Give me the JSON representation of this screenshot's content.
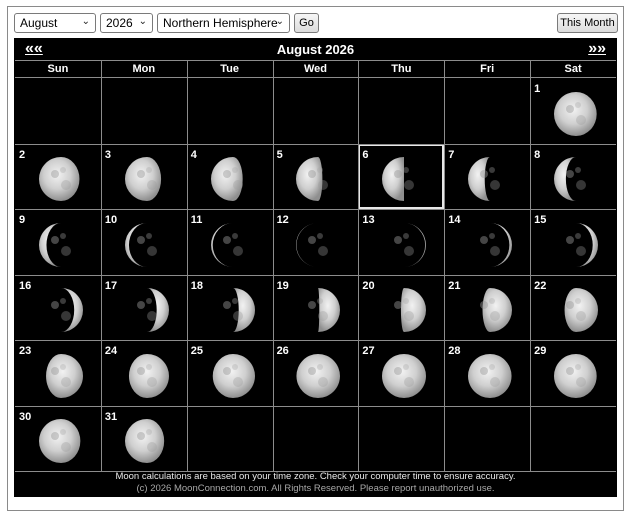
{
  "toolbar": {
    "month_value": "August",
    "year_value": "2026",
    "hemisphere_value": "Northern Hemisphere",
    "go_label": "Go",
    "this_month_label": "This Month"
  },
  "calendar": {
    "title": "August 2026",
    "prev_label": "«",
    "next_label": "»",
    "weekdays": [
      "Sun",
      "Mon",
      "Tue",
      "Wed",
      "Thu",
      "Fri",
      "Sat"
    ],
    "first_weekday_index": 6,
    "days_in_month": 31,
    "highlighted_day": 6,
    "days": [
      {
        "day": 1,
        "phase": 0.97
      },
      {
        "day": 2,
        "phase": 0.92
      },
      {
        "day": 3,
        "phase": 0.82
      },
      {
        "day": 4,
        "phase": 0.72
      },
      {
        "day": 5,
        "phase": 0.6
      },
      {
        "day": 6,
        "phase": 0.5
      },
      {
        "day": 7,
        "phase": 0.38
      },
      {
        "day": 8,
        "phase": 0.27
      },
      {
        "day": 9,
        "phase": 0.17
      },
      {
        "day": 10,
        "phase": 0.09
      },
      {
        "day": 11,
        "phase": 0.04
      },
      {
        "day": 12,
        "phase": 0.01
      },
      {
        "day": 13,
        "phase": 0.02
      },
      {
        "day": 14,
        "phase": 0.06
      },
      {
        "day": 15,
        "phase": 0.12
      },
      {
        "day": 16,
        "phase": 0.2
      },
      {
        "day": 17,
        "phase": 0.28
      },
      {
        "day": 18,
        "phase": 0.37
      },
      {
        "day": 19,
        "phase": 0.47
      },
      {
        "day": 20,
        "phase": 0.57
      },
      {
        "day": 21,
        "phase": 0.67
      },
      {
        "day": 22,
        "phase": 0.76
      },
      {
        "day": 23,
        "phase": 0.84
      },
      {
        "day": 24,
        "phase": 0.91
      },
      {
        "day": 25,
        "phase": 0.96
      },
      {
        "day": 26,
        "phase": 0.99
      },
      {
        "day": 27,
        "phase": 1.0
      },
      {
        "day": 28,
        "phase": 0.99
      },
      {
        "day": 29,
        "phase": 0.97
      },
      {
        "day": 30,
        "phase": 0.94
      },
      {
        "day": 31,
        "phase": 0.89
      }
    ]
  },
  "footer": {
    "line1": "Moon calculations are based on your time zone. Check your computer time to ensure accuracy.",
    "line2": "(c) 2026 MoonConnection.com. All Rights Reserved. Please report unauthorized use."
  },
  "colors": {
    "background": "#000000",
    "grid_lines": "#8c8c8c",
    "moon_lit": "#d9d9d9",
    "highlight": "#e8e8e8"
  }
}
